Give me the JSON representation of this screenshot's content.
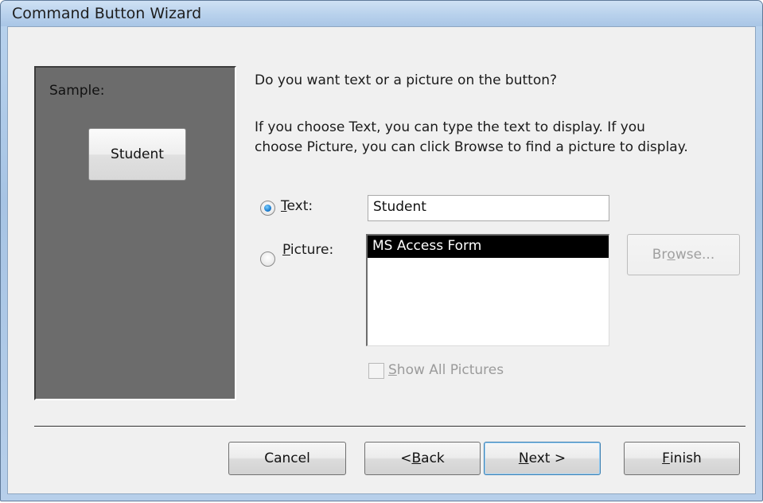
{
  "window": {
    "title": "Command Button Wizard"
  },
  "sample": {
    "label": "Sample:",
    "button_text": "Student"
  },
  "question": "Do you want text or a picture on the button?",
  "instructions": {
    "line1": "If you choose Text, you can type the text to display.  If you",
    "line2": "choose Picture, you can click Browse to find a picture to display."
  },
  "options": {
    "text_option": {
      "mnemonic": "T",
      "label_rest": "ext:",
      "selected": true,
      "value": "Student"
    },
    "picture_option": {
      "mnemonic": "P",
      "label_rest": "icture:",
      "selected": false
    },
    "picture_list": [
      "MS Access Form"
    ],
    "picture_list_selected": "MS Access Form",
    "browse": {
      "pre": "Br",
      "mnemonic": "o",
      "post": "wse...",
      "enabled": false
    },
    "show_all": {
      "mnemonic": "S",
      "label_rest": "how All Pictures",
      "checked": false,
      "enabled": false
    }
  },
  "buttons": {
    "cancel": "Cancel",
    "back": {
      "pre": "< ",
      "mnemonic": "B",
      "post": "ack"
    },
    "next": {
      "mnemonic": "N",
      "post": "ext >"
    },
    "finish": {
      "mnemonic": "F",
      "post": "inish"
    }
  },
  "colors": {
    "title_bar": "#b9d3ee",
    "sample_panel_bg": "#6c6c6c",
    "list_selection": "#000000",
    "radio_selected": "#1f7fd0"
  }
}
